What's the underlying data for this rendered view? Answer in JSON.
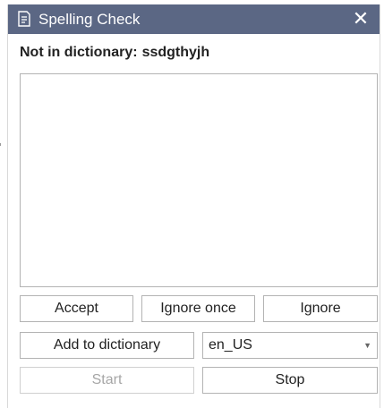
{
  "window": {
    "title": "Spelling Check",
    "close_glyph": "✕",
    "title_icon": "document-check-icon"
  },
  "heading": {
    "label": "Not in dictionary:",
    "word": "ssdgthyjh"
  },
  "suggestions": [],
  "buttons": {
    "accept": "Accept",
    "ignore_once": "Ignore once",
    "ignore": "Ignore",
    "add_to_dictionary": "Add to dictionary",
    "start": "Start",
    "stop": "Stop"
  },
  "language": {
    "selected": "en_US",
    "arrow": "▼"
  },
  "colors": {
    "titlebar": "#5b6784",
    "disabled_text": "#a6a6a6"
  }
}
